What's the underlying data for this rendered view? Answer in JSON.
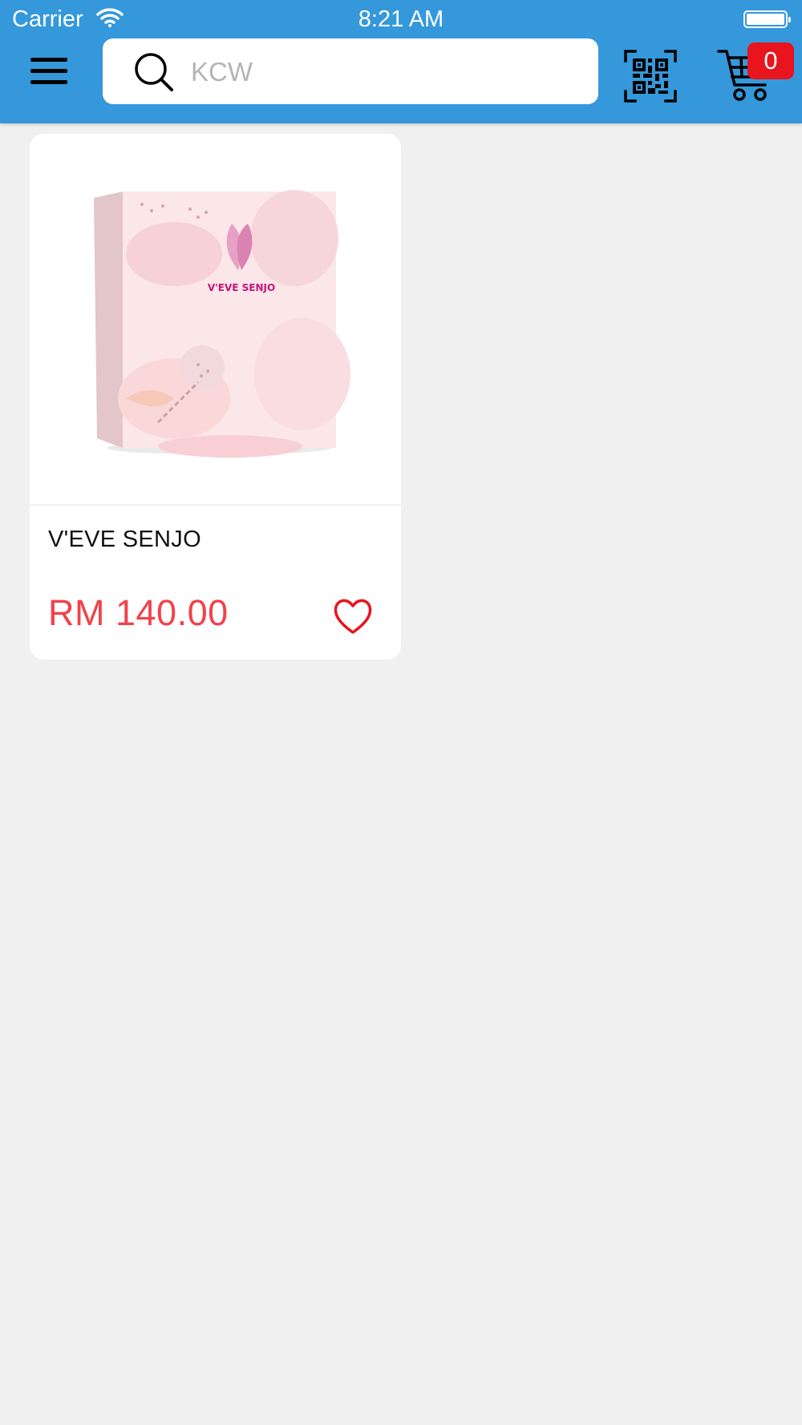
{
  "status_bar": {
    "carrier": "Carrier",
    "time": "8:21 AM"
  },
  "header": {
    "menu_icon": "hamburger-menu-icon",
    "search": {
      "placeholder": "KCW",
      "value": "",
      "icon": "search-icon"
    },
    "qr_icon": "qr-code-scanner-icon",
    "cart": {
      "icon": "shopping-cart-icon",
      "count": "0"
    }
  },
  "colors": {
    "header_bg": "#3498db",
    "page_bg": "#f0f0f0",
    "price": "#f2414b",
    "badge": "#e8141e",
    "favorite": "#e8141e"
  },
  "products": [
    {
      "name": "V'EVE SENJO",
      "price": "RM 140.00",
      "image_brand_text": "V'EVE SENJO",
      "favorite_icon": "heart-outline-icon"
    }
  ]
}
